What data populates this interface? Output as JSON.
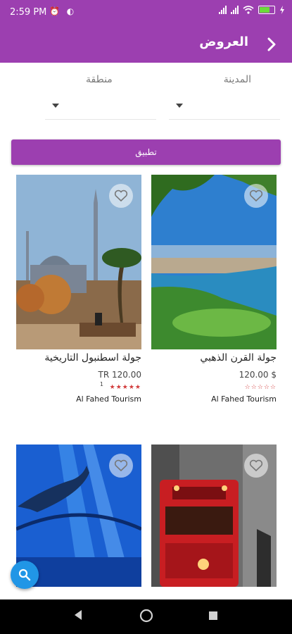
{
  "status": {
    "time": "2:59 PM",
    "icons": "⏰ ◐"
  },
  "appbar": {
    "title": "العروض",
    "back_icon": "chevron-right-icon"
  },
  "filters": {
    "city_label": "المدينة",
    "region_label": "منطقة",
    "city_value": "",
    "region_value": ""
  },
  "apply_label": "تطبيق",
  "cards": [
    {
      "name": "جولة القرن الذهبي",
      "price": "120.00 $",
      "stars": "☆☆☆☆☆",
      "rating_count": "",
      "company": "Al Fahed Tourism"
    },
    {
      "name": "جولة اسطنبول التاريخية",
      "price": "TR 120.00",
      "stars": "★★★★★",
      "rating_count": "1",
      "company": "Al Fahed Tourism"
    },
    {
      "name": "",
      "price": "",
      "stars": "",
      "rating_count": "",
      "company": ""
    },
    {
      "name": "",
      "price": "",
      "stars": "",
      "rating_count": "",
      "company": ""
    }
  ],
  "colors": {
    "primary": "#9c3fb0",
    "fab": "#2196e6",
    "star": "#d23c3c"
  }
}
